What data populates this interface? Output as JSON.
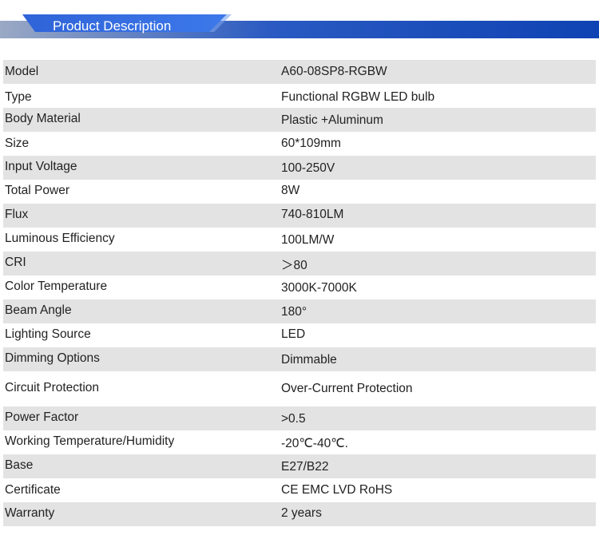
{
  "header": {
    "title": "Product Description"
  },
  "specs": [
    {
      "label": "Model",
      "value": "A60-08SP8-RGBW"
    },
    {
      "label": "Type",
      "value": "Functional RGBW LED bulb"
    },
    {
      "label": "Body Material",
      "value": "Plastic +Aluminum"
    },
    {
      "label": "Size",
      "value": "60*109mm"
    },
    {
      "label": "Input Voltage",
      "value": "100-250V"
    },
    {
      "label": "Total Power",
      "value": "8W"
    },
    {
      "label": "Flux",
      "value": "740-810LM"
    },
    {
      "label": "Luminous Efficiency",
      "value": "100LM/W"
    },
    {
      "label": "CRI",
      "value": "＞80"
    },
    {
      "label": "Color Temperature",
      "value": "3000K-7000K"
    },
    {
      "label": "Beam Angle",
      "value": "180°"
    },
    {
      "label": "Lighting Source",
      "value": "LED"
    },
    {
      "label": "Dimming Options",
      "value": "Dimmable"
    },
    {
      "label": "Circuit Protection",
      "value": "Over-Current Protection"
    },
    {
      "label": "Power Factor",
      "value": ">0.5"
    },
    {
      "label": "Working Temperature/Humidity",
      "value": "-20℃-40℃."
    },
    {
      "label": "Base",
      "value": "E27/B22"
    },
    {
      "label": "Certificate",
      "value": "CE EMC LVD RoHS"
    },
    {
      "label": "Warranty",
      "value": "2 years"
    }
  ]
}
